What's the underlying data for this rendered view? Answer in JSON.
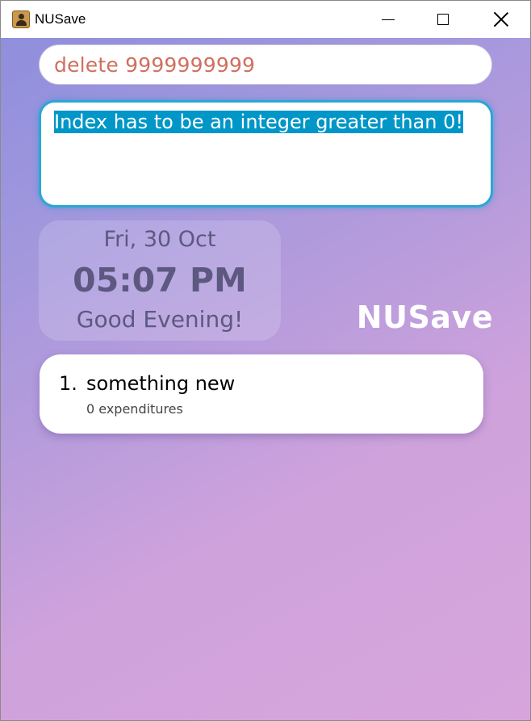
{
  "window": {
    "title": "NUSave",
    "icon": "app-contact-icon"
  },
  "command_box": {
    "value": "delete 9999999999",
    "text_color": "#d0705f"
  },
  "result_box": {
    "message": "Index has to be an integer greater than 0!",
    "highlight_color": "#0096c8"
  },
  "clock": {
    "date": "Fri, 30 Oct",
    "time": "05:07 PM",
    "greeting": "Good Evening!"
  },
  "brand": {
    "name": "NUSave"
  },
  "budget_list": [
    {
      "index": "1.",
      "name": "something new",
      "subtitle": "0 expenditures"
    }
  ]
}
